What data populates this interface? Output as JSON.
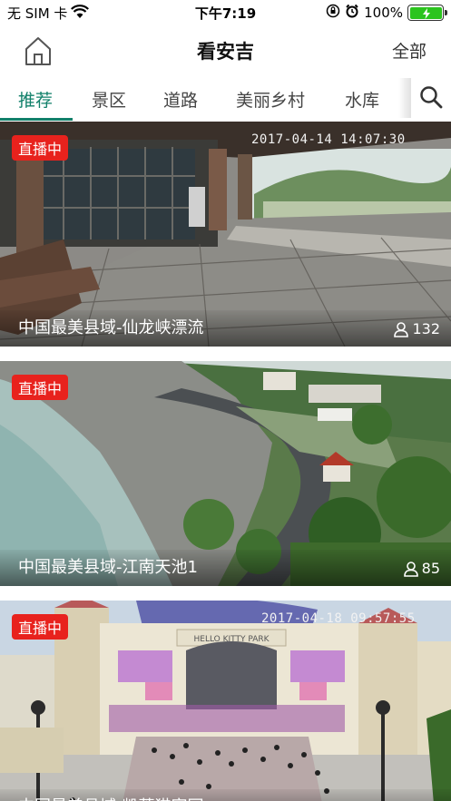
{
  "status_bar": {
    "carrier": "无 SIM 卡",
    "time": "下午7:19",
    "battery_percent": "100%",
    "battery_level": 1.0
  },
  "header": {
    "title": "看安吉",
    "all_label": "全部"
  },
  "tabs": [
    {
      "label": "推荐",
      "active": true
    },
    {
      "label": "景区",
      "active": false
    },
    {
      "label": "道路",
      "active": false
    },
    {
      "label": "美丽乡村",
      "active": false
    },
    {
      "label": "水库",
      "active": false
    }
  ],
  "live_label": "直播中",
  "cards": [
    {
      "title": "中国最美县域-仙龙峡漂流",
      "viewers": "132",
      "timestamp": "2017-04-14 14:07:30"
    },
    {
      "title": "中国最美县域-江南天池1",
      "viewers": "85",
      "timestamp": ""
    },
    {
      "title": "中国最美县域-凯蒂猫家园",
      "viewers": "",
      "timestamp": "2017-04-18 09:57:55",
      "sign_text": "HELLO KITTY PARK"
    }
  ],
  "colors": {
    "accent": "#11806a",
    "live_badge": "#e8221d",
    "battery": "#2bc41e"
  }
}
